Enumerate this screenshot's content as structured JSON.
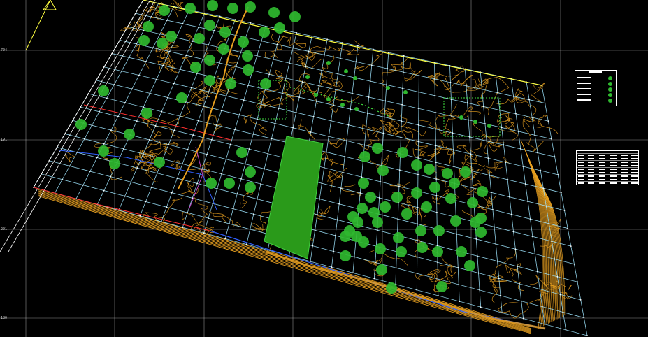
{
  "drawing": {
    "background_color": "#000000",
    "colors": {
      "frame_grid": "#ffffff",
      "survey_grid": "#9fe6ff",
      "contours": "#e8a020",
      "trees": "#2fb82f",
      "plaza": "#2a9a1a",
      "boundary_yellow": "#ffff40",
      "boundary_red": "#ff3030",
      "water_blue": "#3060ff",
      "path_magenta": "#c040c0",
      "legend_bg": "#ffffff"
    },
    "icons": [
      "north-arrow-icon",
      "tree-symbol-icon"
    ],
    "coordinate_ticks": [
      "704",
      "191",
      "201",
      "180"
    ]
  }
}
